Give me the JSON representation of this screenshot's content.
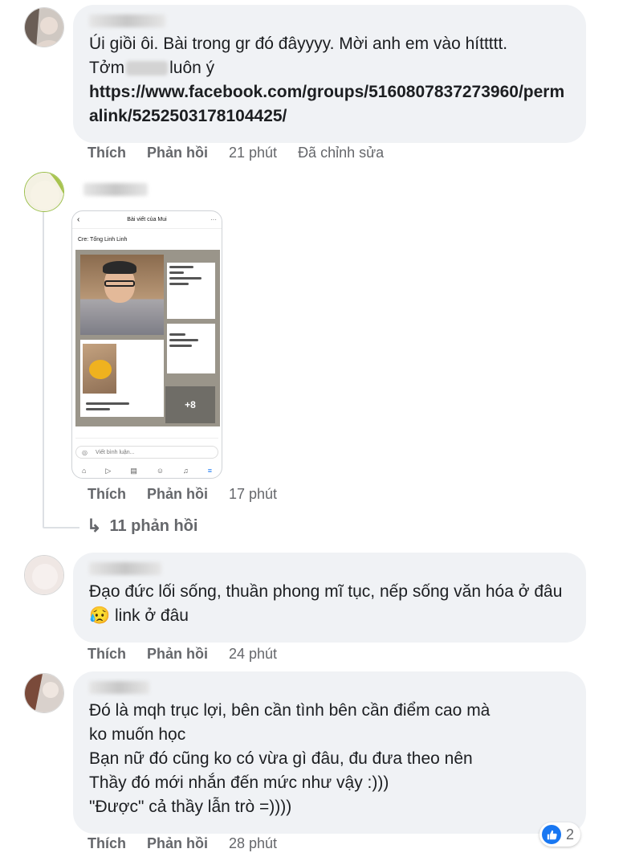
{
  "comments": [
    {
      "text_line1": "Úi giồi ôi. Bài trong gr đó đâyyyy. Mời anh em vào híttttt.",
      "text_line2_before": "Tởm",
      "text_line2_after": "luôn ý",
      "link": "https://www.facebook.com/groups/5160807837273960/permalink/5252503178104425/",
      "like_label": "Thích",
      "reply_label": "Phản hồi",
      "time": "21 phút",
      "edited": "Đã chỉnh sửa"
    },
    {
      "like_label": "Thích",
      "reply_label": "Phản hồi",
      "time": "17 phút",
      "replies": "11 phản hồi",
      "screenshot": {
        "header": "Bài viết của Mui",
        "credit": "Cre: Tống Linh Linh",
        "more_count": "+8",
        "input_placeholder": "Viết bình luận..."
      }
    },
    {
      "text": "Đạo đức lối sống, thuần phong mĩ tục, nếp sống văn hóa ở đâu 😥 link ở đâu",
      "like_label": "Thích",
      "reply_label": "Phản hồi",
      "time": "24 phút"
    },
    {
      "line1": "Đó là mqh trục lợi, bên cần tình bên cần điểm cao mà",
      "line2": "ko muốn học",
      "line3": "Bạn nữ đó cũng ko có vừa gì đâu, đu đưa theo nên",
      "line4": "Thầy đó mới nhắn đến mức như vậy :)))",
      "line5": "\"Được\" cả thầy lẫn trò =))))",
      "like_label": "Thích",
      "reply_label": "Phản hồi",
      "time": "28 phút",
      "reaction_count": "2"
    }
  ],
  "colors": {
    "bubble": "#f0f2f5",
    "meta": "#65676b",
    "like": "#1877f2"
  }
}
